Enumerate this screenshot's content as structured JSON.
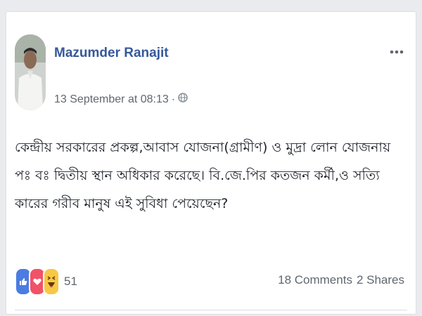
{
  "post": {
    "author": "Mazumder Ranajit",
    "timestamp": "13 September at 08:13",
    "separator": "·",
    "privacy_icon": "globe-icon",
    "text": "কেন্দ্রীয় সরকারের প্রকল্প,আবাস যোজনা(গ্রামীণ) ও মুদ্রা লোন যোজনায় পঃ বঃ দ্বিতীয় স্থান অধিকার করেছে। বি.জে.পির কতজন কর্মী,ও সত্যি কারের গরীব মানুষ এই সুবিধা পেয়েছেন?",
    "reactions": {
      "types": [
        "like",
        "love",
        "haha"
      ],
      "count": "51"
    },
    "comments_label": "18 Comments",
    "shares_label": "2 Shares"
  },
  "colors": {
    "author": "#365899",
    "like": "#4a7ce2",
    "love": "#f25268",
    "haha": "#f7c844"
  }
}
